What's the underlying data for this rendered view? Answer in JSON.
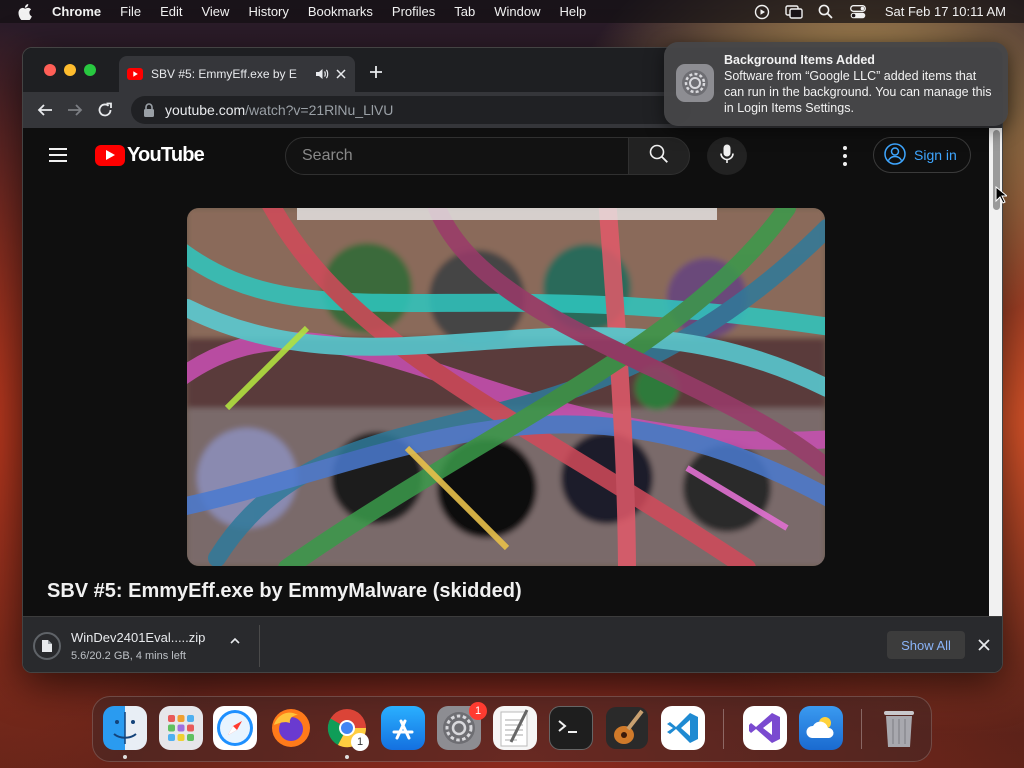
{
  "menubar": {
    "app_name": "Chrome",
    "items": [
      "File",
      "Edit",
      "View",
      "History",
      "Bookmarks",
      "Profiles",
      "Tab",
      "Window",
      "Help"
    ],
    "clock": "Sat Feb 17  10:11 AM"
  },
  "browser": {
    "tab": {
      "title": "SBV #5: EmmyEff.exe by E",
      "favicon": "youtube-icon"
    },
    "url": {
      "host": "youtube.com",
      "path": "/watch?v=21RlNu_LlVU"
    }
  },
  "youtube": {
    "logo_text": "YouTube",
    "search_placeholder": "Search",
    "signin_label": "Sign in",
    "video_title": "SBV #5: EmmyEff.exe by EmmyMalware (skidded)"
  },
  "download": {
    "filename": "WinDev2401Eval.....zip",
    "status": "5.6/20.2 GB, 4 mins left",
    "show_all": "Show All"
  },
  "notification": {
    "title": "Background Items Added",
    "body": "Software from “Google LLC” added items that can run in the background. You can manage this in Login Items Settings."
  },
  "dock": {
    "apps": [
      "finder",
      "launchpad",
      "safari",
      "firefox",
      "chrome",
      "app-store",
      "system-settings",
      "textedit",
      "terminal",
      "garageband",
      "vscode",
      "visual-studio",
      "weather",
      "trash"
    ],
    "system_settings_badge": "1",
    "chrome_badge": "1"
  },
  "colors": {
    "youtube_red": "#ff0000",
    "link_blue": "#3ea6ff",
    "notification_bg": "#464648"
  }
}
